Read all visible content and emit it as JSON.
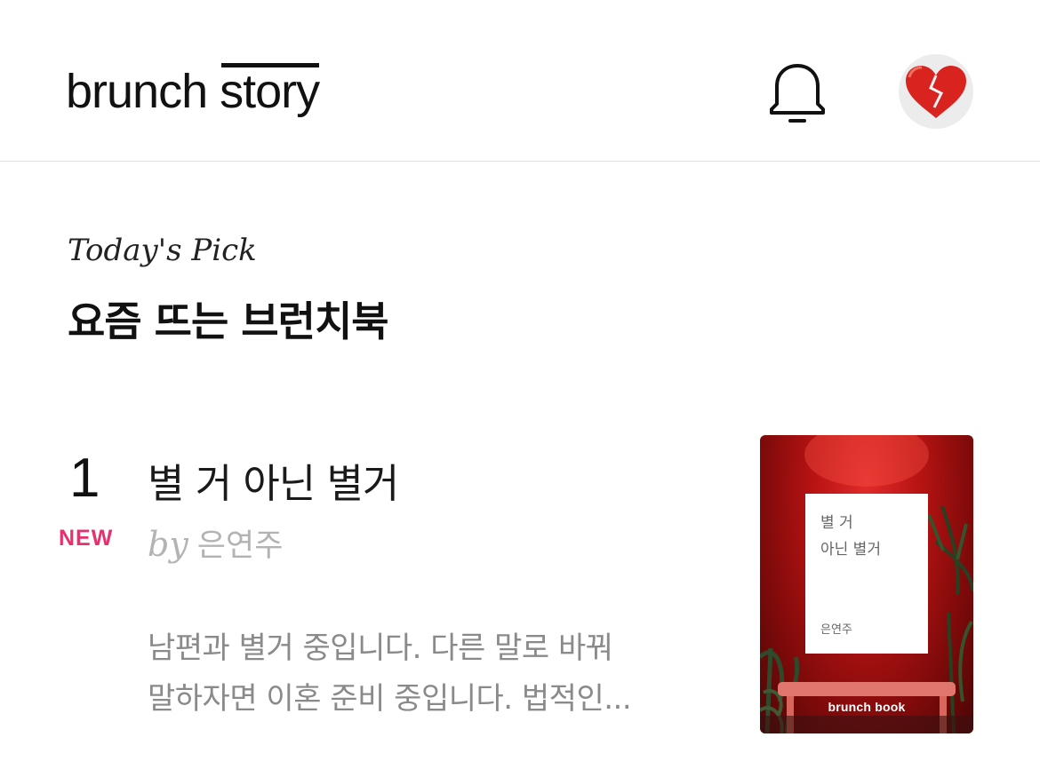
{
  "header": {
    "logo": {
      "part1": "brunch",
      "part2": "story"
    },
    "notification_icon": "bell-icon",
    "avatar_icon": "heart-avatar"
  },
  "section": {
    "subtitle": "Today's Pick",
    "title": "요즘 뜨는 브런치북"
  },
  "books": [
    {
      "rank": "1",
      "badge": "NEW",
      "title": "별 거 아닌 별거",
      "by": "by",
      "author": "은연주",
      "excerpt_lines": [
        "남편과 별거 중입니다. 다른 말로 바꿔",
        "말하자면 이혼 준비 중입니다. 법적인..."
      ],
      "cover": {
        "title_lines": [
          "별 거",
          "아닌 별거"
        ],
        "author": "은연주",
        "brand": "brunch book"
      }
    }
  ],
  "colors": {
    "new_badge": "#e8306f",
    "cover_red": "#b81313",
    "text_muted": "#8a8a8a"
  }
}
